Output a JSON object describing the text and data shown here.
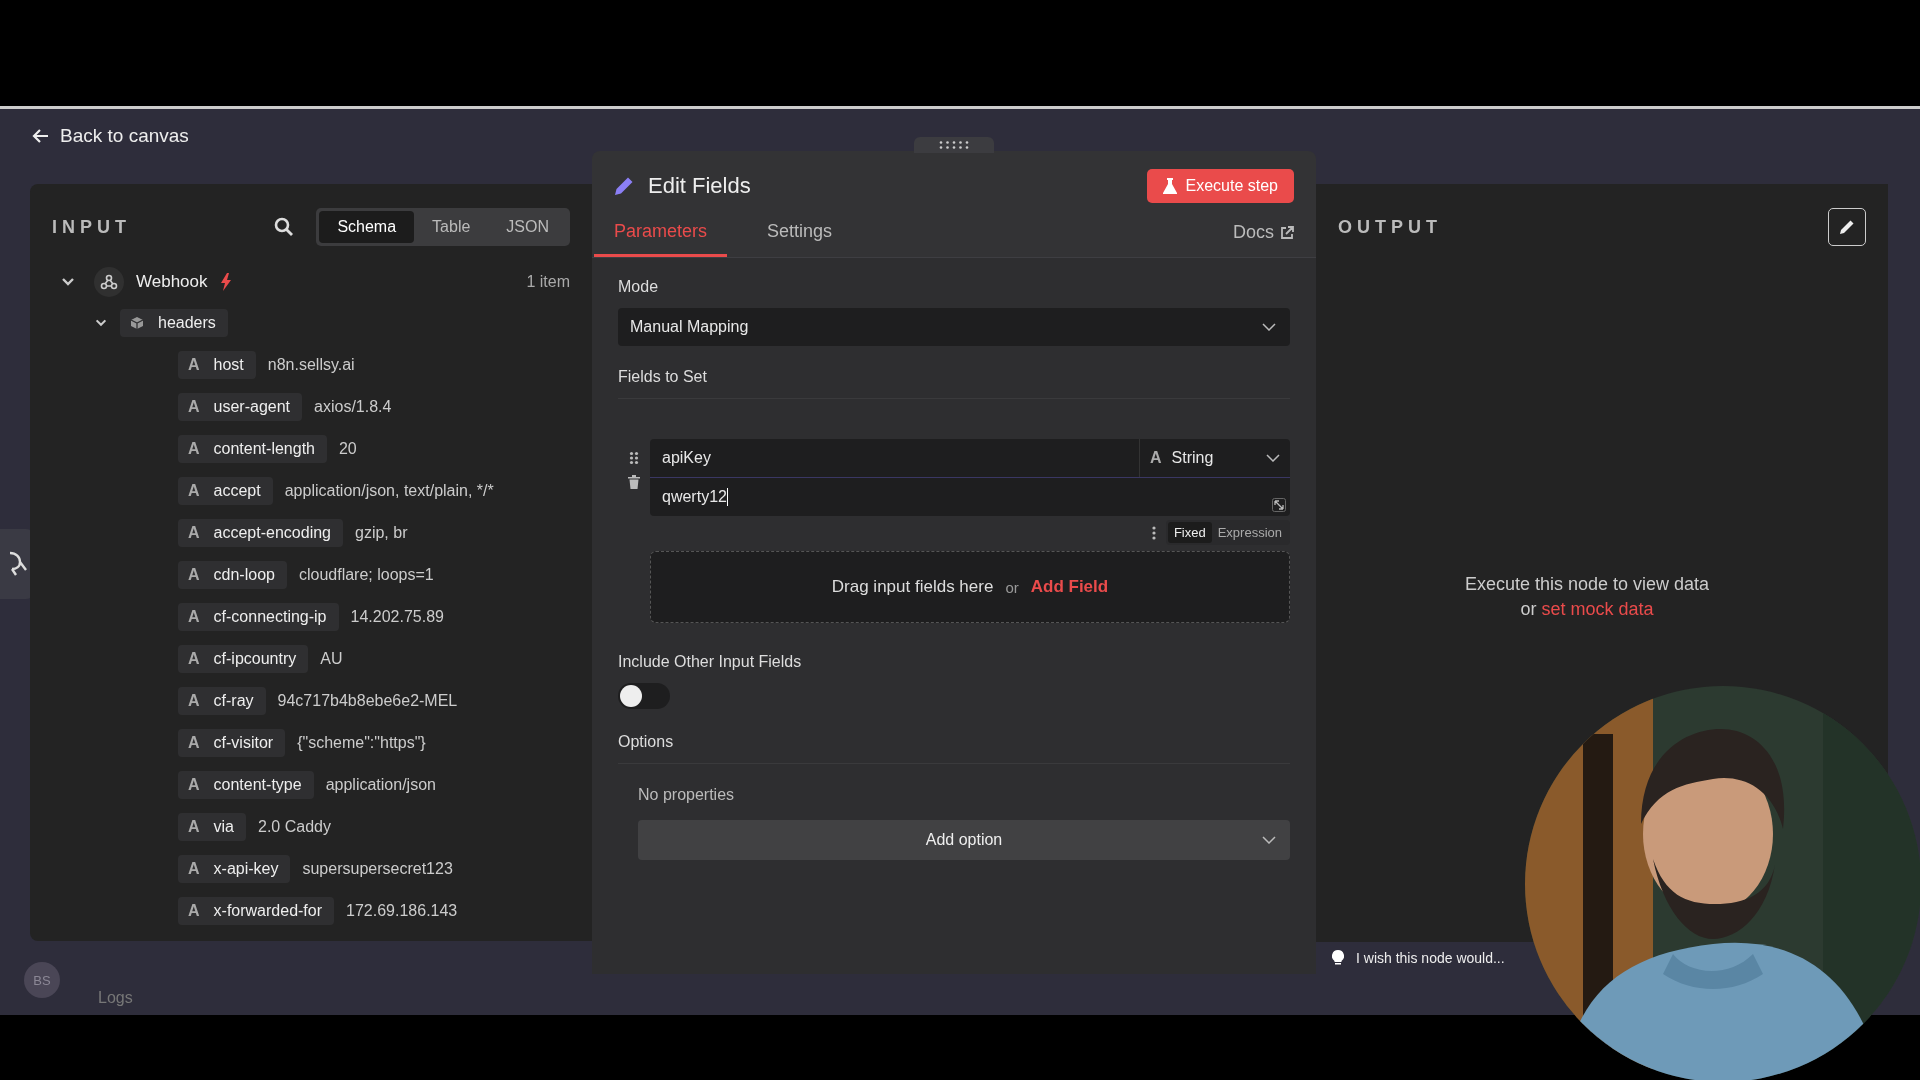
{
  "header": {
    "back_link": "Back to canvas"
  },
  "input_panel": {
    "title": "INPUT",
    "view_tabs": [
      {
        "label": "Schema",
        "selected": true
      },
      {
        "label": "Table",
        "selected": false
      },
      {
        "label": "JSON",
        "selected": false
      }
    ],
    "node": {
      "name": "Webhook",
      "count": "1 item",
      "expanded": true,
      "children": [
        {
          "name": "headers",
          "expanded": true,
          "children": [
            {
              "type_label": "A",
              "name": "host",
              "value": "n8n.sellsy.ai"
            },
            {
              "type_label": "A",
              "name": "user-agent",
              "value": "axios/1.8.4"
            },
            {
              "type_label": "A",
              "name": "content-length",
              "value": "20"
            },
            {
              "type_label": "A",
              "name": "accept",
              "value": "application/json, text/plain, */*"
            },
            {
              "type_label": "A",
              "name": "accept-encoding",
              "value": "gzip, br"
            },
            {
              "type_label": "A",
              "name": "cdn-loop",
              "value": "cloudflare; loops=1"
            },
            {
              "type_label": "A",
              "name": "cf-connecting-ip",
              "value": "14.202.75.89"
            },
            {
              "type_label": "A",
              "name": "cf-ipcountry",
              "value": "AU"
            },
            {
              "type_label": "A",
              "name": "cf-ray",
              "value": "94c717b4b8ebe6e2-MEL"
            },
            {
              "type_label": "A",
              "name": "cf-visitor",
              "value": "{\"scheme\":\"https\"}"
            },
            {
              "type_label": "A",
              "name": "content-type",
              "value": "application/json"
            },
            {
              "type_label": "A",
              "name": "via",
              "value": "2.0 Caddy"
            },
            {
              "type_label": "A",
              "name": "x-api-key",
              "value": "supersupersecret123"
            },
            {
              "type_label": "A",
              "name": "x-forwarded-for",
              "value": "172.69.186.143"
            }
          ]
        }
      ]
    }
  },
  "editor": {
    "title": "Edit Fields",
    "execute_button": "Execute step",
    "tabs": [
      {
        "label": "Parameters",
        "selected": true
      },
      {
        "label": "Settings",
        "selected": false
      }
    ],
    "docs_link": "Docs",
    "mode": {
      "label": "Mode",
      "value": "Manual Mapping"
    },
    "fields_label": "Fields to Set",
    "assignments": [
      {
        "name": "apiKey",
        "type_label": "A",
        "type": "String",
        "value": "qwerty12",
        "value_modes": [
          {
            "label": "Fixed",
            "selected": true
          },
          {
            "label": "Expression",
            "selected": false
          }
        ]
      }
    ],
    "drop_zone": {
      "text": "Drag input fields here",
      "separator": "or",
      "link": "Add Field"
    },
    "include_other": {
      "label": "Include Other Input Fields",
      "on": false
    },
    "options": {
      "label": "Options",
      "empty_text": "No properties",
      "add_button": "Add option"
    }
  },
  "output_panel": {
    "title": "OUTPUT",
    "empty_text": "Execute this node to view data",
    "separator": "or",
    "mock_link": "set mock data",
    "feedback_placeholder": "I wish this node would..."
  },
  "footer": {
    "avatar": "BS",
    "logs_label": "Logs"
  }
}
